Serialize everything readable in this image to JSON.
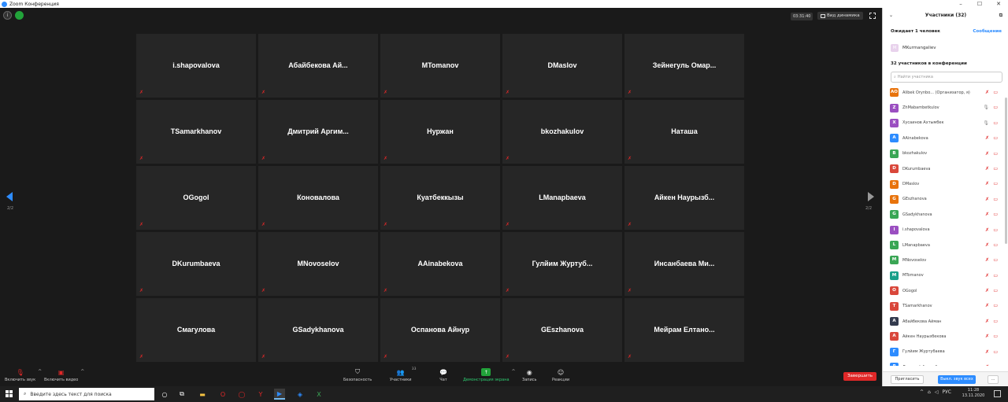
{
  "window": {
    "title": "Zoom Конференция",
    "controls": [
      "–",
      "☐",
      "✕"
    ]
  },
  "meeting": {
    "timer": "03:31:40",
    "view_label": "Вид динамика",
    "page_indicator_left": "2/2",
    "page_indicator_right": "2/2",
    "tiles": [
      "i.shapovalova",
      "Абайбекова Ай...",
      "MTomanov",
      "DMaslov",
      "Зейнегуль Омар...",
      "TSamarkhanov",
      "Дмитрий Аргим...",
      "Нуржан",
      "bkozhakulov",
      "Наташа",
      "OGogol",
      "Коновалова",
      "Куатбеккызы",
      "LManapbaeva",
      "Айкен Наурызб...",
      "DKurumbaeva",
      "MNovoselov",
      "AAinabekova",
      "Гулйим Журтуб...",
      "Инсанбаева Ми...",
      "Смагулова",
      "GSadykhanova",
      "Оспанова Айнур",
      "GEszhanova",
      "Мейрам Елтано..."
    ]
  },
  "toolbar": {
    "unmute_label": "Включить звук",
    "start_video_label": "Включить видео",
    "security_label": "Безопасность",
    "participants_label": "Участники",
    "participants_count": "33",
    "chat_label": "Чат",
    "share_label": "Демонстрация экрана",
    "record_label": "Запись",
    "reactions_label": "Реакции",
    "end_label": "Завершить"
  },
  "panel": {
    "title": "Участники (32)",
    "waiting_title": "Ожидает 1 человек",
    "message_link": "Сообщение",
    "waiting_person": {
      "initial": "M",
      "name": "MKurmangaliev"
    },
    "in_meeting_title": "32 участников в конференции",
    "search_placeholder": "Найти участника",
    "participants": [
      {
        "initials": "AO",
        "name": "Alibek Orynbo... (Организатор, я)",
        "color": "#e8730c",
        "mic": "off"
      },
      {
        "initials": "Z",
        "name": "ZhMabambetkulov",
        "color": "#9b4fc1",
        "mic": "on"
      },
      {
        "initials": "Х",
        "name": "Хусаинов Ахтымбек",
        "color": "#9b4fc1",
        "mic": "on"
      },
      {
        "initials": "A",
        "name": "AAinabekova",
        "color": "#2d8cff",
        "mic": "off"
      },
      {
        "initials": "B",
        "name": "bkozhakulov",
        "color": "#3aa655",
        "mic": "off"
      },
      {
        "initials": "D",
        "name": "DKurumbaeva",
        "color": "#d9473b",
        "mic": "off"
      },
      {
        "initials": "D",
        "name": "DMaslov",
        "color": "#e8730c",
        "mic": "off"
      },
      {
        "initials": "G",
        "name": "GEszhanova",
        "color": "#e8730c",
        "mic": "off"
      },
      {
        "initials": "G",
        "name": "GSadykhanova",
        "color": "#3aa655",
        "mic": "off"
      },
      {
        "initials": "I",
        "name": "i.shapovalova",
        "color": "#9b4fc1",
        "mic": "off"
      },
      {
        "initials": "L",
        "name": "LManapbaeva",
        "color": "#3aa655",
        "mic": "off"
      },
      {
        "initials": "M",
        "name": "MNovoselov",
        "color": "#3aa655",
        "mic": "off"
      },
      {
        "initials": "M",
        "name": "MTomanov",
        "color": "#19a08a",
        "mic": "off"
      },
      {
        "initials": "O",
        "name": "OGogol",
        "color": "#d9473b",
        "mic": "off"
      },
      {
        "initials": "T",
        "name": "TSamarkhanov",
        "color": "#d9473b",
        "mic": "off"
      },
      {
        "initials": "A",
        "name": "Абайбекова Айман",
        "color": "#333a4d",
        "mic": "off"
      },
      {
        "initials": "A",
        "name": "Айкен Наурызбекова",
        "color": "#d9473b",
        "mic": "off"
      },
      {
        "initials": "Г",
        "name": "Гулйим Журтубаева",
        "color": "#2d8cff",
        "mic": "off"
      },
      {
        "initials": "Д",
        "name": "Дмитрий Аргимбаев",
        "color": "#2d8cff",
        "mic": "off"
      }
    ],
    "invite_label": "Пригласить",
    "mute_all_label": "Выкл. звук всех",
    "more_label": "..."
  },
  "taskbar": {
    "search_placeholder": "Введите здесь текст для поиска",
    "lang": "РУС",
    "time": "11:28",
    "date": "13.11.2020"
  },
  "colors": {
    "accent": "#2d8cff",
    "danger": "#e02828",
    "share": "#22a33a"
  }
}
